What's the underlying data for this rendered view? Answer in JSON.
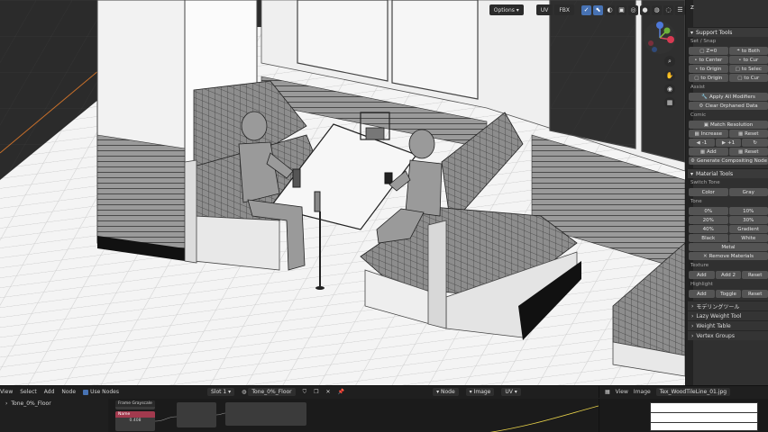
{
  "viewport_header": {
    "options_label": "Options",
    "uv_label": "UV",
    "fbx_label": "FBX"
  },
  "gizmo": {
    "axis_labels": [
      "Z",
      "Y",
      "X"
    ]
  },
  "npanel": {
    "header_label": "Z",
    "support_tools": {
      "title": "Support Tools",
      "set_snap_label": "Set / Snap",
      "rows": [
        [
          "Z=0",
          "to Both"
        ],
        [
          "to Center",
          "to Cur"
        ],
        [
          "to Origin",
          "to Selec"
        ],
        [
          "to Origin",
          "to Cur"
        ]
      ]
    },
    "assist": {
      "label": "Assist",
      "apply_all_modifiers": "Apply All Modifiers",
      "clear_orphaned_data": "Clear Orphaned Data"
    },
    "comic": {
      "label": "Comic",
      "match_resolution": "Match Resolution",
      "increase": "Increase",
      "reset_1": "Reset",
      "minus_one": "-1",
      "plus_one": "+1",
      "add": "Add",
      "reset_2": "Reset",
      "generate_compositing": "Generate Compositing Node"
    },
    "material_tools": {
      "title": "Material Tools",
      "switch_tone_label": "Switch Tone",
      "color": "Color",
      "gray": "Gray",
      "tone_label": "Tone",
      "tones": [
        [
          "0%",
          "10%"
        ],
        [
          "20%",
          "30%"
        ],
        [
          "40%",
          "Gradient"
        ],
        [
          "Black",
          "White"
        ]
      ],
      "metal": "Metal",
      "remove_materials": "Remove Materials",
      "texture_label": "Texture",
      "texture_add": "Add",
      "texture_add2": "Add 2",
      "texture_reset": "Reset",
      "highlight_label": "Highlight",
      "highlight_add": "Add",
      "highlight_toggle": "Toggle",
      "highlight_reset": "Reset"
    },
    "collapsed": [
      "モデリングツール",
      "Lazy Weight Tool",
      "Weight Table",
      "Vertex Groups"
    ]
  },
  "node_editor": {
    "menu": [
      "View",
      "Select",
      "Add",
      "Node"
    ],
    "use_nodes": "Use Nodes",
    "slot": "Slot 1",
    "material": "Tone_0%_Floor",
    "outliner_item": "Tone_0%_Floor",
    "nodes": {
      "frame_title": "Frame Grayscale",
      "red_title": "Name",
      "value_label": "0.408"
    }
  },
  "uv_editor": {
    "menu_node": "Node",
    "menu_image": "Image",
    "menu_uv": "UV",
    "menu_view": "View",
    "menu_image2": "Image",
    "image_name": "Tex_WoodTileLine_01.jpg"
  },
  "colors": {
    "accent": "#4772b3",
    "panel_bg": "#303030",
    "button": "#545454",
    "node_red": "#a23a4e"
  }
}
